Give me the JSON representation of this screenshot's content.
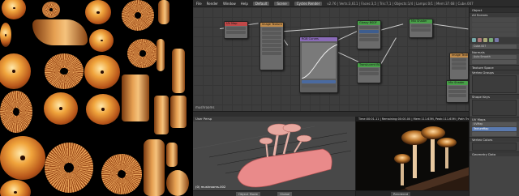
{
  "topbar": {
    "items": [
      "File",
      "Render",
      "Window",
      "Help",
      "Default",
      "Scene",
      "Cycles Render",
      "v2.76 | Verts:3,611 | Faces:3,5 | Tris:7,1 | Objects:1/4 | Lamps:0/1 | Mem:37.68 | Cube.007"
    ]
  },
  "node_editor": {
    "label": "mushrooms",
    "nodes": [
      {
        "title": "UV Map",
        "color": "#c04848"
      },
      {
        "title": "Image Texture",
        "color": "#c08a48"
      },
      {
        "title": "RGB Curves",
        "color": "#8a6bb8"
      },
      {
        "title": "Glossy BSDF",
        "color": "#48a048"
      },
      {
        "title": "Translucent BSDF",
        "color": "#48a048"
      },
      {
        "title": "Mix Shader",
        "color": "#48a048"
      },
      {
        "title": "Mix Shader",
        "color": "#48a048"
      },
      {
        "title": "Image Texture",
        "color": "#c08a48"
      }
    ]
  },
  "properties": {
    "header": "Object",
    "sections": [
      "All Scenes",
      "Cube.007",
      "Normals",
      "Auto Smooth",
      "Texture Space",
      "Vertex Groups",
      "Shape Keys",
      "UV Maps",
      "Vertex Colors",
      "Geometry Data"
    ],
    "uv_items": [
      "UVMap",
      "TextureMap"
    ]
  },
  "viewport": {
    "header": "User Persp",
    "object_label": "(0) mushrooms.002",
    "mode": "Object Mode",
    "shading": "Global"
  },
  "render": {
    "header": "Time:00:01.11 | Remaining:00:00.00 | Mem:111.63M, Peak:111.63M | Path Tracing Sa",
    "mode": "Rendered"
  }
}
